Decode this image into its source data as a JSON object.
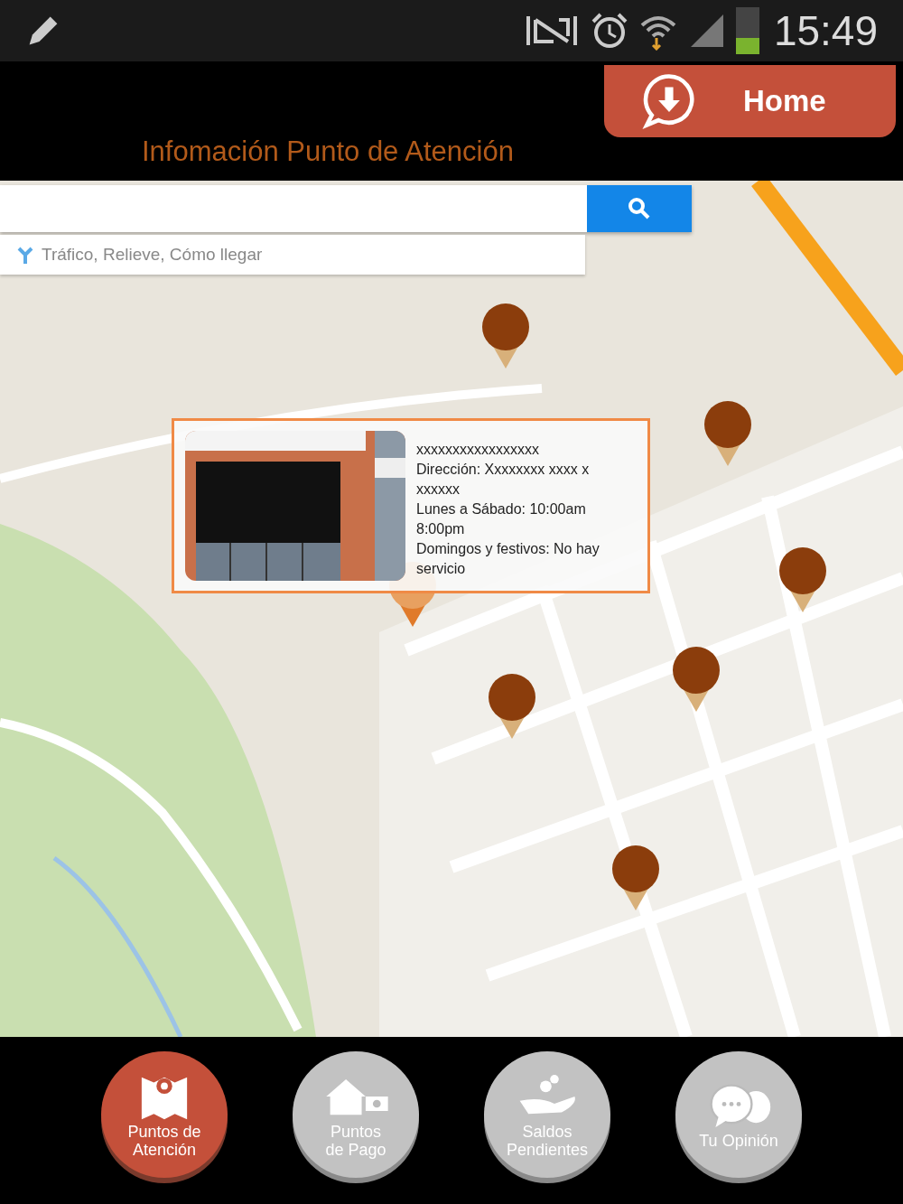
{
  "status_bar": {
    "time": "15:49"
  },
  "header": {
    "title": "Infomación Punto de Atención",
    "home_button": "Home"
  },
  "search": {
    "options_link": "Tráfico, Relieve, Cómo llegar"
  },
  "popup": {
    "kind": "picture",
    "lines": [
      " xxxxxxxxxxxxxxxxx",
      "Dirección: Xxxxxxxx xxxx x xxxxxx",
      "Lunes a Sábado: 10:00am 8:00pm",
      "Domingos y festivos: No hay servicio"
    ]
  },
  "nav": [
    {
      "kind": "map",
      "label_lines": [
        "Puntos de",
        "Atención"
      ],
      "selected": true
    },
    {
      "kind": "house",
      "label_lines": [
        "Puntos",
        "de Pago"
      ],
      "selected": false
    },
    {
      "kind": "coins",
      "label_lines": [
        "Saldos",
        "Pendientes"
      ],
      "selected": false
    },
    {
      "kind": "chat",
      "label_lines": [
        "Tu Opinión"
      ],
      "selected": false
    }
  ]
}
